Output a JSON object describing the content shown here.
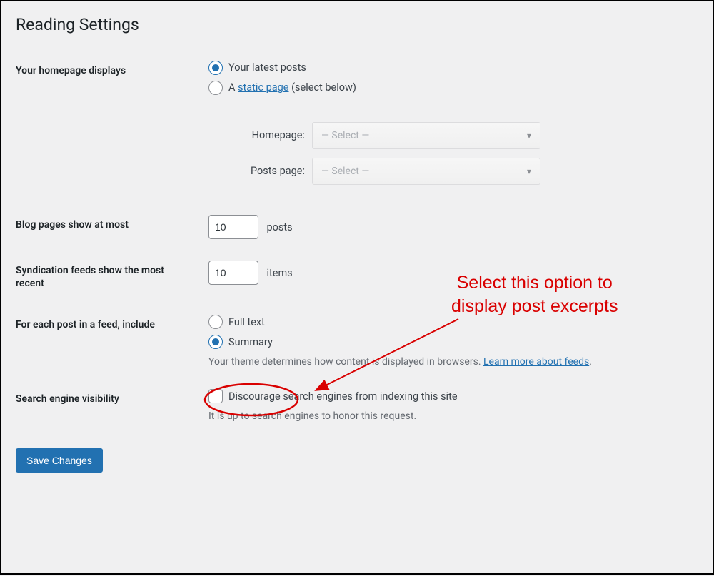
{
  "page": {
    "title": "Reading Settings"
  },
  "homepage": {
    "label": "Your homepage displays",
    "options": {
      "latest": "Your latest posts",
      "static_prefix": "A ",
      "static_link": "static page",
      "static_suffix": " (select below)"
    },
    "dropdowns": {
      "homepage_label": "Homepage:",
      "posts_page_label": "Posts page:",
      "placeholder": "— Select —"
    }
  },
  "blog_pages": {
    "label": "Blog pages show at most",
    "value": "10",
    "unit": "posts"
  },
  "syndication": {
    "label": "Syndication feeds show the most recent",
    "value": "10",
    "unit": "items"
  },
  "feed_content": {
    "label": "For each post in a feed, include",
    "options": {
      "full": "Full text",
      "summary": "Summary"
    },
    "description_text": "Your theme determines how content is displayed in browsers. ",
    "description_link": "Learn more about feeds",
    "description_suffix": "."
  },
  "search_visibility": {
    "label": "Search engine visibility",
    "checkbox_label": "Discourage search engines from indexing this site",
    "description": "It is up to search engines to honor this request."
  },
  "submit": {
    "label": "Save Changes"
  },
  "annotation": {
    "line1": "Select this option to",
    "line2": "display post excerpts"
  }
}
